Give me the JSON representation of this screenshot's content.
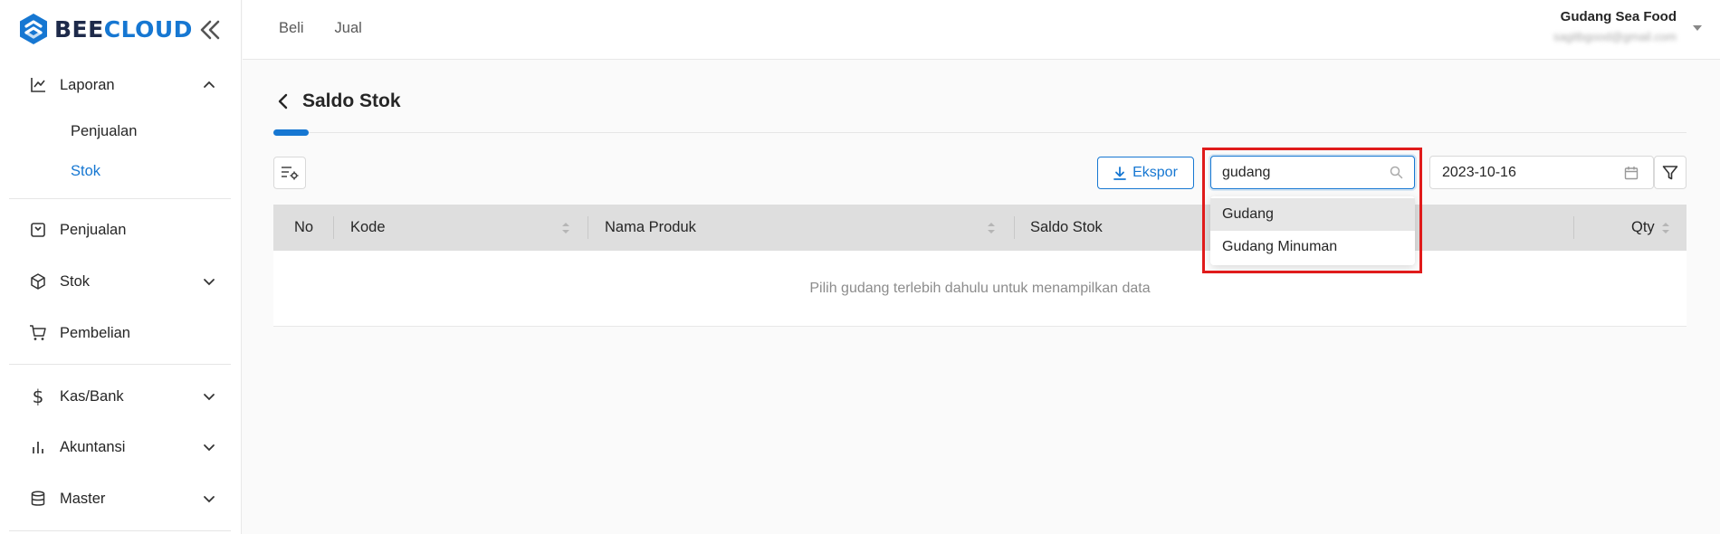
{
  "app": {
    "logo_part1": "BEE",
    "logo_part2": "CLOUD"
  },
  "colors": {
    "accent": "#1677d2",
    "highlight": "#e01b1b"
  },
  "sidebar": {
    "items": [
      {
        "label": "Laporan",
        "icon": "chart-line-icon",
        "expanded": true
      },
      {
        "label": "Penjualan",
        "icon": "receipt-icon"
      },
      {
        "label": "Stok",
        "icon": "box-icon"
      },
      {
        "label": "Pembelian",
        "icon": "cart-icon"
      },
      {
        "label": "Kas/Bank",
        "icon": "dollar-icon"
      },
      {
        "label": "Akuntansi",
        "icon": "bar-chart-icon"
      },
      {
        "label": "Master",
        "icon": "database-icon"
      }
    ],
    "subitems": [
      {
        "label": "Penjualan"
      },
      {
        "label": "Stok",
        "active": true
      }
    ]
  },
  "topbar": {
    "nav": [
      "Beli",
      "Jual"
    ],
    "account_name": "Gudang Sea Food",
    "account_email": "sagitbgood@gmail.com"
  },
  "page": {
    "title": "Saldo Stok",
    "export_label": "Ekspor",
    "search_value": "gudang",
    "dropdown_options": [
      "Gudang",
      "Gudang Minuman"
    ],
    "date_value": "2023-10-16"
  },
  "table": {
    "columns": [
      "No",
      "Kode",
      "Nama Produk",
      "Saldo Stok",
      "Qty"
    ],
    "empty_text": "Pilih gudang terlebih dahulu untuk menampilkan data"
  }
}
